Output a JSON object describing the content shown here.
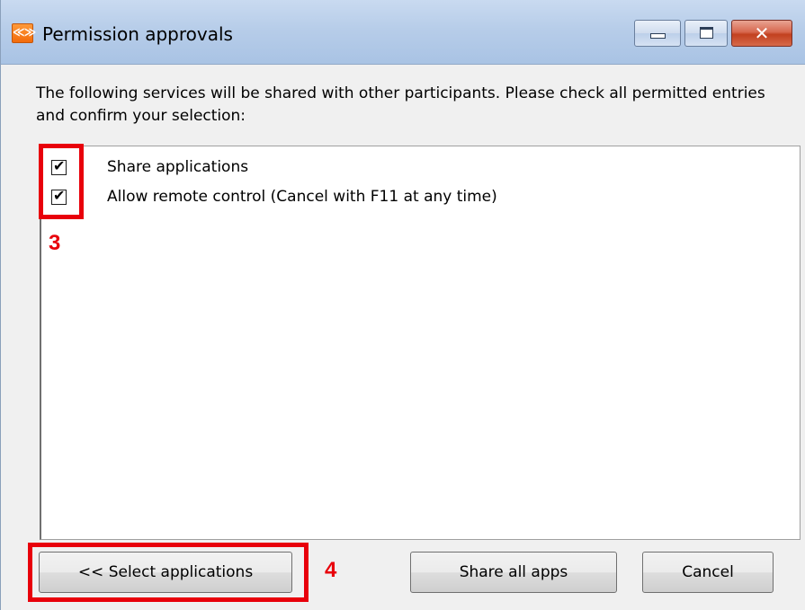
{
  "window": {
    "title": "Permission approvals",
    "app_icon_text": "≪≫"
  },
  "description": "The following services will be shared with other participants. Please check all permitted entries and confirm your selection:",
  "permissions": [
    {
      "label": "Share applications",
      "checked": true
    },
    {
      "label": "Allow remote control (Cancel with F11 at any time)",
      "checked": true
    }
  ],
  "annotations": {
    "checkbox_marker": "3",
    "button_marker": "4",
    "color": "#e8000b"
  },
  "buttons": {
    "select_applications": "<< Select applications",
    "share_all_apps": "Share all apps",
    "cancel": "Cancel"
  },
  "title_buttons": {
    "close_glyph": "✕"
  }
}
